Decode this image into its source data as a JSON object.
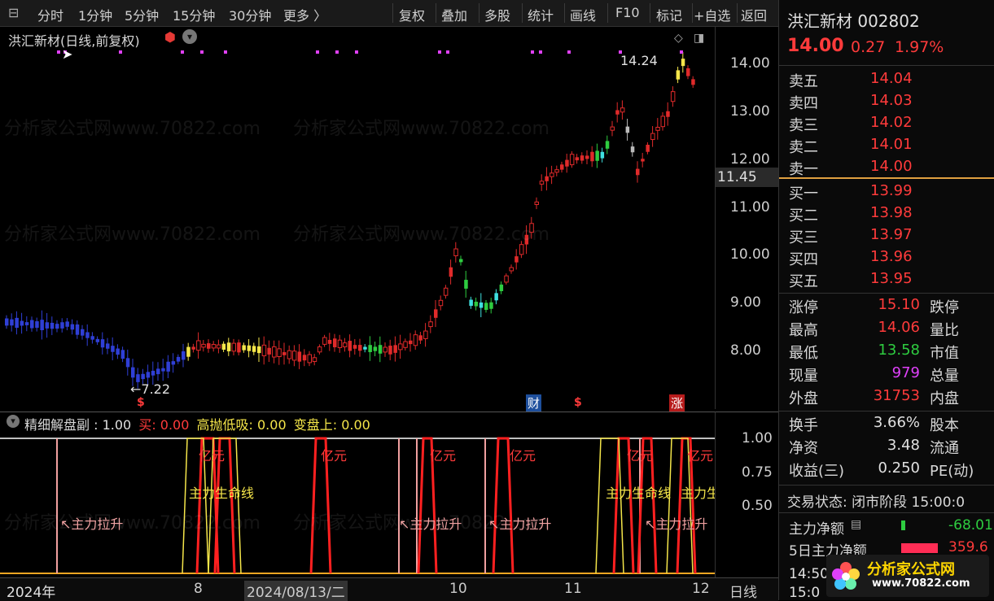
{
  "toolbar": {
    "tabs": [
      "分时",
      "1分钟",
      "5分钟",
      "15分钟",
      "30分钟",
      "更多 〉"
    ],
    "tools": [
      "复权",
      "叠加",
      "多股",
      "统计",
      "画线",
      "F10",
      "标记",
      "+自选",
      "返回"
    ]
  },
  "chart": {
    "title": "洪汇新材(日线,前复权)",
    "price_ticks": [
      "14.00",
      "13.00",
      "12.00",
      "11.00",
      "10.00",
      "9.00",
      "8.00"
    ],
    "current_price_label": "11.45",
    "high_label": "14.24",
    "low_label": "←7.22",
    "markers": [
      "$",
      "财",
      "$",
      "涨"
    ],
    "watermark": "分析家公式网www.70822.com"
  },
  "sub": {
    "title": "精细解盘副",
    "value": ": 1.00",
    "buy_label": "买: 0.00",
    "dip_label": "高抛低吸: 0.00",
    "turn_label": "变盘上: 0.00",
    "ticks": [
      "1.00",
      "0.75",
      "0.50"
    ],
    "annotations": [
      "↖主力拉升",
      "↖主力拉升",
      "↖主力拉升",
      "↖主力拉升",
      "亿元",
      "亿元",
      "亿元",
      "亿元",
      "亿元",
      "亿元",
      "主力生命线",
      "主力生命线",
      "主力生命线"
    ]
  },
  "dates": [
    "2024年",
    "8",
    "2024/08/13/二",
    "10",
    "11",
    "12",
    "日线"
  ],
  "quote": {
    "name": "洪汇新材 002802",
    "price": "14.00",
    "change": "0.27",
    "pct": "1.97%",
    "asks": [
      {
        "label": "卖五",
        "price": "14.04"
      },
      {
        "label": "卖四",
        "price": "14.03"
      },
      {
        "label": "卖三",
        "price": "14.02"
      },
      {
        "label": "卖二",
        "price": "14.01"
      },
      {
        "label": "卖一",
        "price": "14.00"
      }
    ],
    "bids": [
      {
        "label": "买一",
        "price": "13.99"
      },
      {
        "label": "买二",
        "price": "13.98"
      },
      {
        "label": "买三",
        "price": "13.97"
      },
      {
        "label": "买四",
        "price": "13.96"
      },
      {
        "label": "买五",
        "price": "13.95"
      }
    ],
    "stats": [
      {
        "l1": "涨停",
        "v1": "15.10",
        "l2": "跌停",
        "c": "red"
      },
      {
        "l1": "最高",
        "v1": "14.06",
        "l2": "量比",
        "c": "red"
      },
      {
        "l1": "最低",
        "v1": "13.58",
        "l2": "市值",
        "c": "green"
      },
      {
        "l1": "现量",
        "v1": "979",
        "l2": "总量",
        "c": "magenta"
      },
      {
        "l1": "外盘",
        "v1": "31753",
        "l2": "内盘",
        "c": "red"
      }
    ],
    "fin": [
      {
        "l1": "换手",
        "v1": "3.66%",
        "l2": "股本"
      },
      {
        "l1": "净资",
        "v1": "3.48",
        "l2": "流通"
      },
      {
        "l1": "收益(三)",
        "v1": "0.250",
        "l2": "PE(动)"
      }
    ],
    "status": "交易状态: 闭市阶段 15:00:0",
    "net_flow_label": "主力净额",
    "net_flow_value": "-68.01",
    "net5_label": "5日主力净额",
    "net5_value": "359.6",
    "time1": "14:50",
    "time2": "15:0",
    "logo_text": "分析家公式网",
    "logo_url": "www.70822.com"
  }
}
